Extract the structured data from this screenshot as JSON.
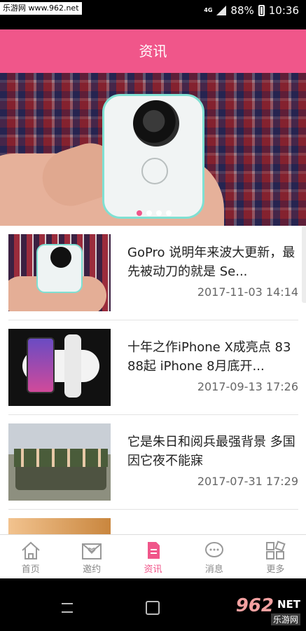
{
  "status_bar": {
    "site_tag": "乐游网 www.962.net",
    "net_type": "4G",
    "battery": "88%",
    "time": "10:36"
  },
  "header": {
    "title": "资讯"
  },
  "banner": {
    "dots": 4,
    "active_dot": 0
  },
  "news": [
    {
      "title": "GoPro 说明年来波大更新，最先被动刀的就是 Se...",
      "date": "2017-11-03 14:14"
    },
    {
      "title": "十年之作iPhone X成亮点 8388起 iPhone 8月底开...",
      "date": "2017-09-13 17:26"
    },
    {
      "title": "它是朱日和阅兵最强背景 多国因它夜不能寐",
      "date": "2017-07-31 17:29"
    },
    {
      "title": "",
      "date": ""
    }
  ],
  "tabs": [
    {
      "label": "首页",
      "icon": "home-icon"
    },
    {
      "label": "邀约",
      "icon": "invite-icon"
    },
    {
      "label": "资讯",
      "icon": "news-icon",
      "active": true
    },
    {
      "label": "消息",
      "icon": "message-icon"
    },
    {
      "label": "更多",
      "icon": "more-icon"
    }
  ],
  "watermark": {
    "num": "962",
    "net": "NET",
    "sub": "乐游网"
  },
  "colors": {
    "accent": "#f0568a"
  }
}
